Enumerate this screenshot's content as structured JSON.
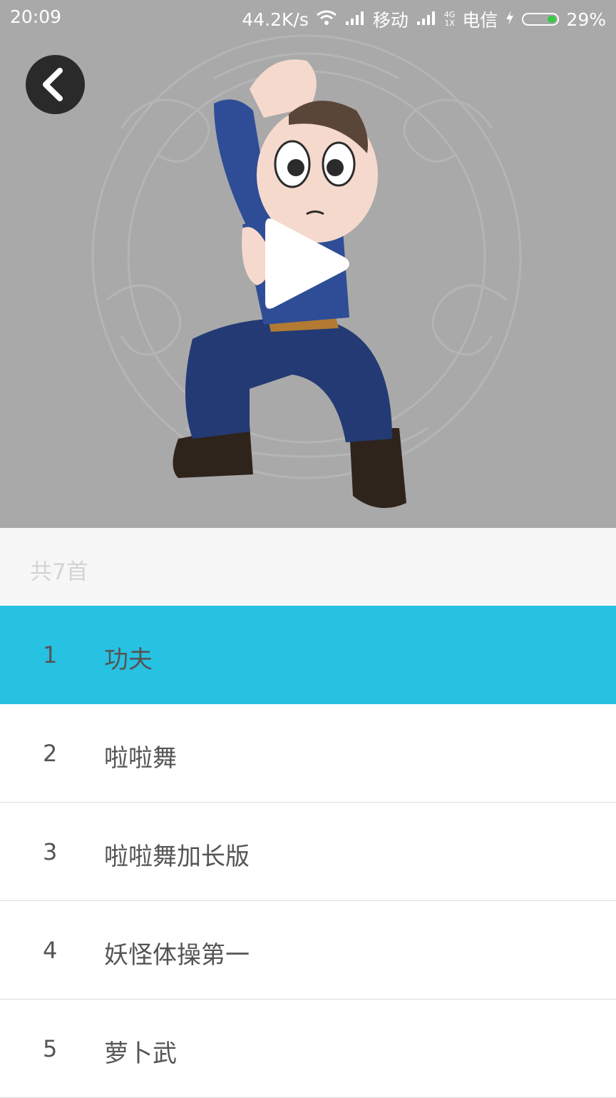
{
  "status_bar": {
    "time": "20:09",
    "net_speed": "44.2K/s",
    "carrier1": "移动",
    "net_type_top": "4G",
    "net_type_bottom": "1X",
    "carrier2": "电信",
    "battery": "29%"
  },
  "list": {
    "count_label": "共7首",
    "tracks": [
      {
        "num": "1",
        "title": "功夫",
        "active": true
      },
      {
        "num": "2",
        "title": "啦啦舞",
        "active": false
      },
      {
        "num": "3",
        "title": "啦啦舞加长版",
        "active": false
      },
      {
        "num": "4",
        "title": "妖怪体操第一",
        "active": false
      },
      {
        "num": "5",
        "title": "萝卜武",
        "active": false
      }
    ]
  },
  "colors": {
    "accent": "#27c1e2",
    "hero_bg": "#a9a9aa",
    "count_bar_bg": "#f7f7f7"
  },
  "icons": [
    "back-arrow-icon",
    "play-icon",
    "wifi-icon",
    "signal-icon",
    "charging-icon",
    "battery-icon"
  ]
}
